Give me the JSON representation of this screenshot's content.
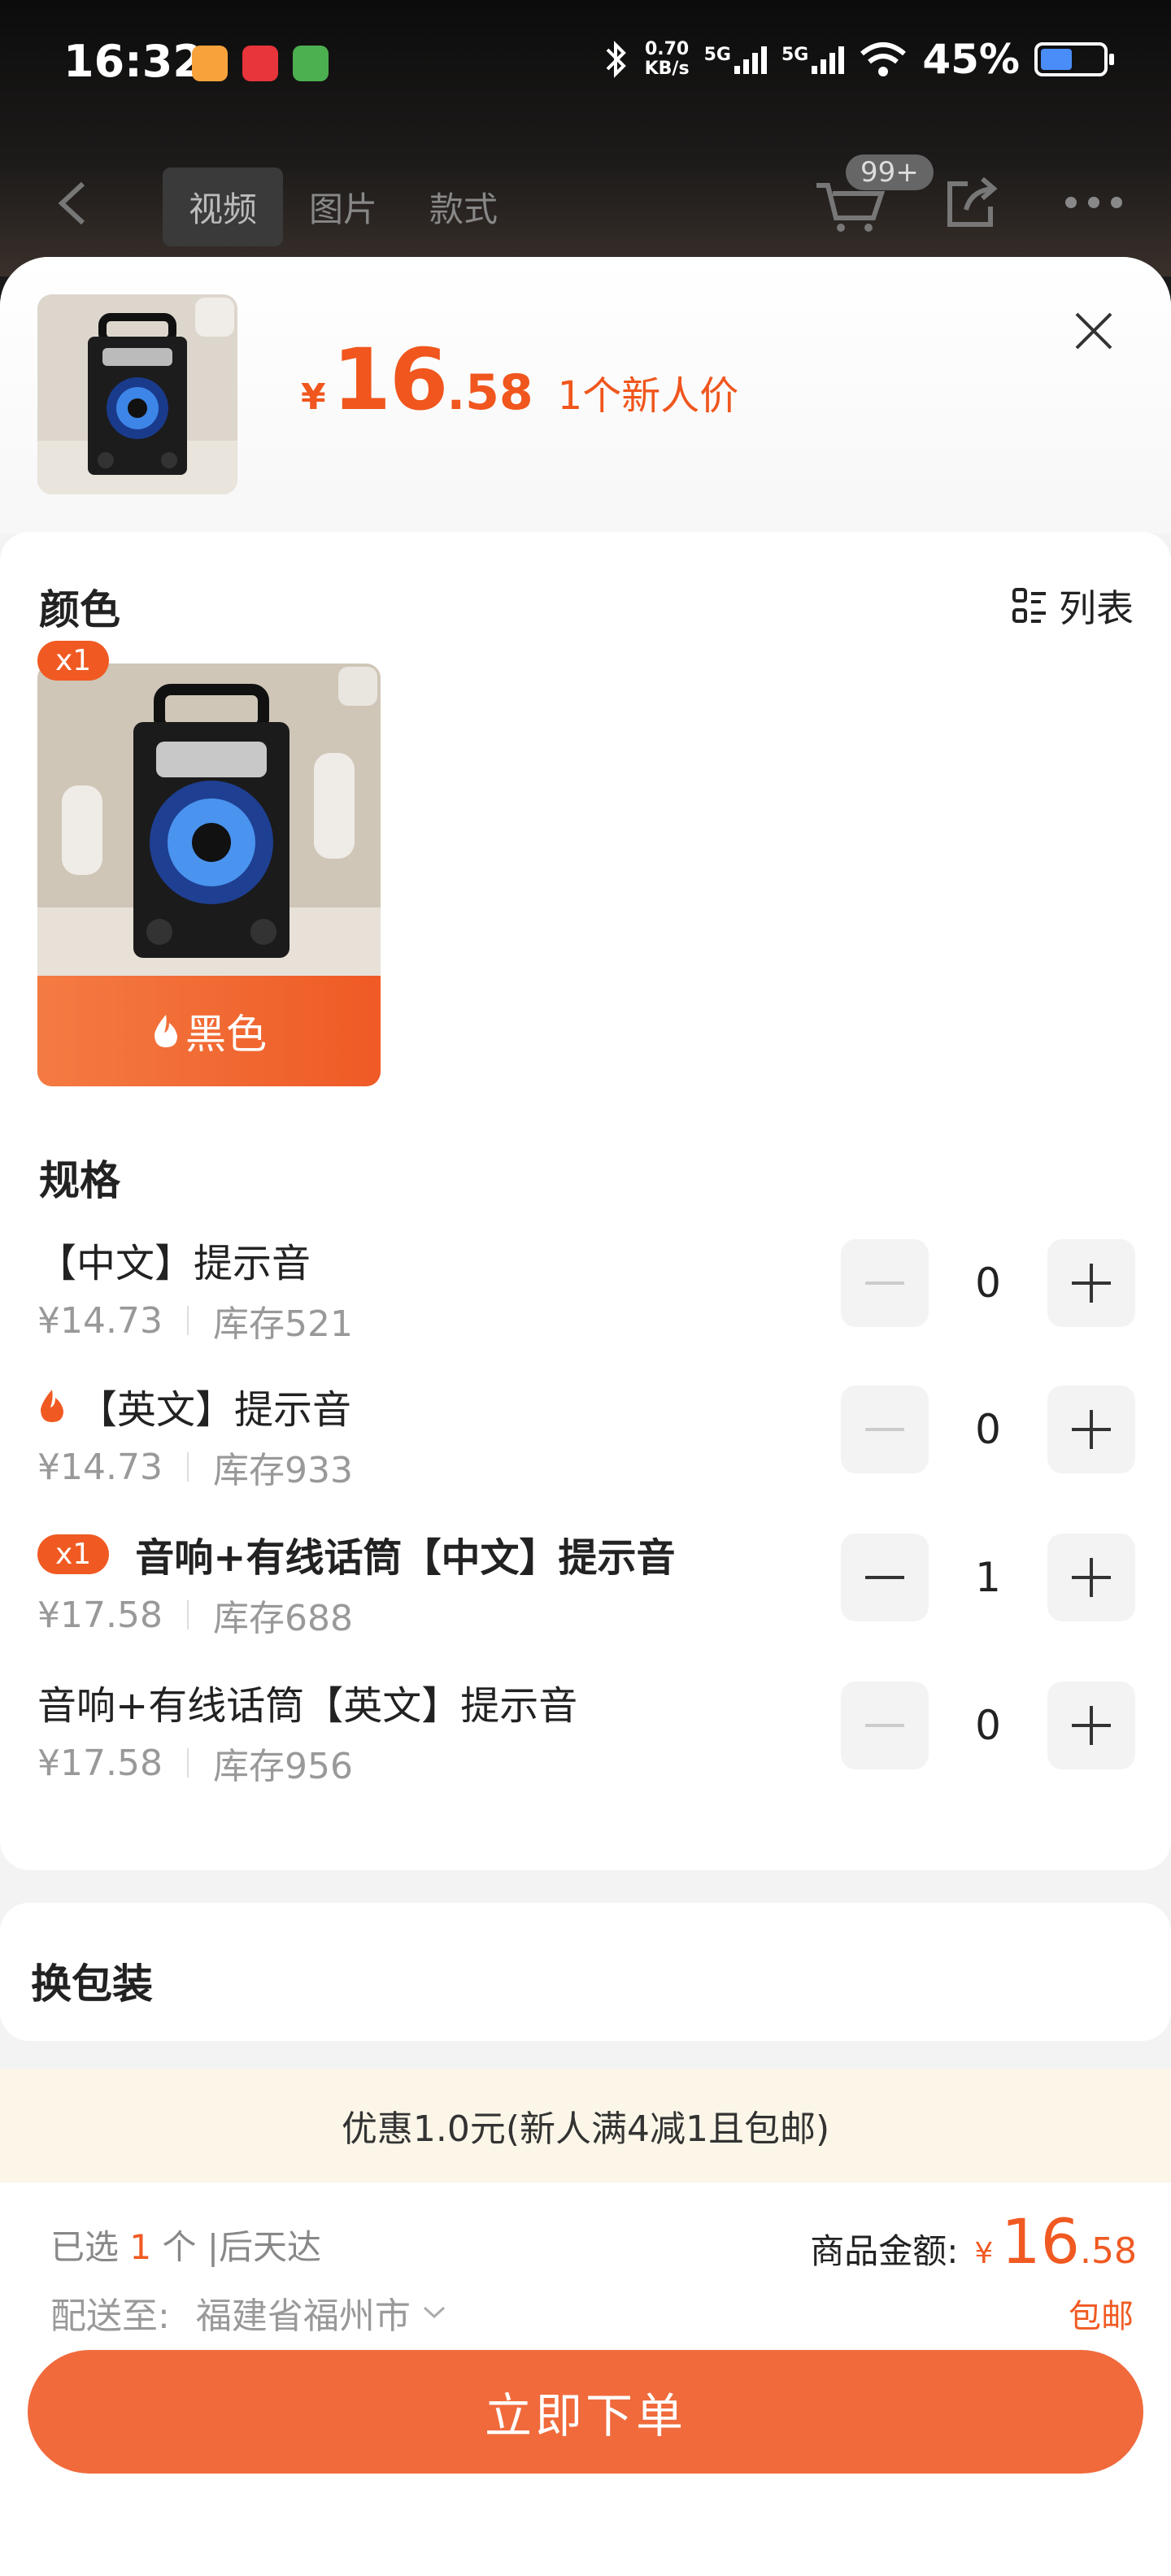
{
  "status_bar": {
    "time": "16:32",
    "net_speed_value": "0.70",
    "net_speed_unit": "KB/s",
    "signal1": "5G",
    "signal2": "5G",
    "battery": "45%",
    "app_icon_colors": [
      "#f7a23b",
      "#e8343b",
      "#4caf50"
    ]
  },
  "nav": {
    "tabs": [
      "视频",
      "图片",
      "款式"
    ],
    "active_tab": "视频",
    "cart_badge": "99+"
  },
  "header": {
    "price_symbol": "¥",
    "price_int": "16",
    "price_dec": ".58",
    "price_note": "1个新人价"
  },
  "color_section": {
    "title": "颜色",
    "list_toggle": "列表",
    "option": {
      "qty_tag": "x1",
      "name": "黑色",
      "hot_icon": "fire-icon"
    }
  },
  "spec_section": {
    "title": "规格",
    "rows": [
      {
        "name": "【中文】提示音",
        "price": "¥14.73",
        "stock": "库存521",
        "qty": "0",
        "hot": false,
        "tag": "",
        "selected": false
      },
      {
        "name": "【英文】提示音",
        "price": "¥14.73",
        "stock": "库存933",
        "qty": "0",
        "hot": true,
        "tag": "",
        "selected": false
      },
      {
        "name": "音响+有线话筒【中文】提示音",
        "price": "¥17.58",
        "stock": "库存688",
        "qty": "1",
        "hot": false,
        "tag": "x1",
        "selected": true
      },
      {
        "name": "音响+有线话筒【英文】提示音",
        "price": "¥17.58",
        "stock": "库存956",
        "qty": "0",
        "hot": false,
        "tag": "",
        "selected": false
      }
    ]
  },
  "package_section": {
    "title": "换包装"
  },
  "promo": {
    "text": "优惠1.0元(新人满4减1且包邮)"
  },
  "footer": {
    "selected_prefix": "已选",
    "selected_count": "1",
    "selected_suffix": "个 |后天达",
    "amount_label": "商品金额:",
    "amount_symbol": "¥",
    "amount_int": "16",
    "amount_dec": ".58",
    "ship_label": "配送至:",
    "ship_location": "福建省福州市",
    "free_shipping": "包邮",
    "order_button": "立即下单"
  },
  "colors": {
    "accent": "#f05a22",
    "order_button": "#f06a3c",
    "promo_bg": "#fbf6e8"
  }
}
